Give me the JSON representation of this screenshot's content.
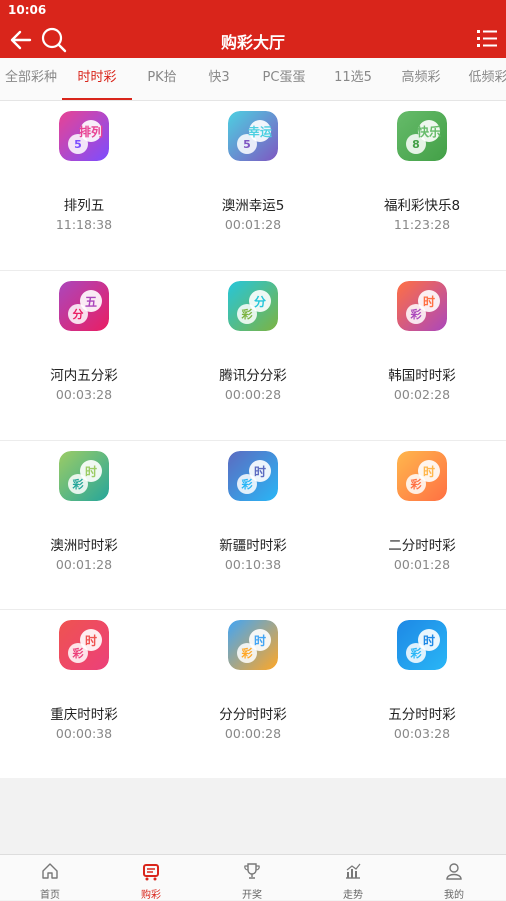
{
  "status": {
    "time": "10:06"
  },
  "header": {
    "title": "购彩大厅",
    "back_icon": "back-arrow-icon",
    "search_icon": "search-icon",
    "menu_icon": "list-menu-icon"
  },
  "tabs": [
    {
      "label": "全部彩种",
      "active": false
    },
    {
      "label": "时时彩",
      "active": true
    },
    {
      "label": "PK拾",
      "active": false
    },
    {
      "label": "快3",
      "active": false
    },
    {
      "label": "PC蛋蛋",
      "active": false
    },
    {
      "label": "11选5",
      "active": false
    },
    {
      "label": "高频彩",
      "active": false
    },
    {
      "label": "低频彩",
      "active": false
    }
  ],
  "lotteries": [
    {
      "name": "排列五",
      "time": "11:18:38",
      "icon_text": "排列",
      "icon_sub": "5",
      "colors": [
        "#e84393",
        "#7c4dff"
      ]
    },
    {
      "name": "澳洲幸运5",
      "time": "00:01:28",
      "icon_text": "幸运",
      "icon_sub": "5",
      "colors": [
        "#4dd0e1",
        "#7e57c2"
      ]
    },
    {
      "name": "福利彩快乐8",
      "time": "11:23:28",
      "icon_text": "快乐",
      "icon_sub": "8",
      "colors": [
        "#66bb6a",
        "#43a047"
      ]
    },
    {
      "name": "河内五分彩",
      "time": "00:03:28",
      "icon_text": "五",
      "icon_sub": "分",
      "colors": [
        "#ab47bc",
        "#e91e63"
      ]
    },
    {
      "name": "腾讯分分彩",
      "time": "00:00:28",
      "icon_text": "分",
      "icon_sub": "彩",
      "colors": [
        "#26c6da",
        "#7cb342"
      ]
    },
    {
      "name": "韩国时时彩",
      "time": "00:02:28",
      "icon_text": "时",
      "icon_sub": "彩",
      "colors": [
        "#ff7043",
        "#ab47bc"
      ]
    },
    {
      "name": "澳洲时时彩",
      "time": "00:01:28",
      "icon_text": "时",
      "icon_sub": "彩",
      "colors": [
        "#9ccc65",
        "#26a69a"
      ]
    },
    {
      "name": "新疆时时彩",
      "time": "00:10:38",
      "icon_text": "时",
      "icon_sub": "彩",
      "colors": [
        "#5c6bc0",
        "#29b6f6"
      ]
    },
    {
      "name": "二分时时彩",
      "time": "00:01:28",
      "icon_text": "时",
      "icon_sub": "彩",
      "colors": [
        "#ffb74d",
        "#ff7043"
      ]
    },
    {
      "name": "重庆时时彩",
      "time": "00:00:38",
      "icon_text": "时",
      "icon_sub": "彩",
      "colors": [
        "#ef5350",
        "#ec407a"
      ]
    },
    {
      "name": "分分时时彩",
      "time": "00:00:28",
      "icon_text": "时",
      "icon_sub": "彩",
      "colors": [
        "#42a5f5",
        "#ffa726"
      ]
    },
    {
      "name": "五分时时彩",
      "time": "00:03:28",
      "icon_text": "时",
      "icon_sub": "彩",
      "colors": [
        "#1e88e5",
        "#29b6f6"
      ]
    }
  ],
  "nav": [
    {
      "label": "首页",
      "icon": "home-icon",
      "active": false
    },
    {
      "label": "购彩",
      "icon": "cart-icon",
      "active": true
    },
    {
      "label": "开奖",
      "icon": "trophy-icon",
      "active": false
    },
    {
      "label": "走势",
      "icon": "chart-icon",
      "active": false
    },
    {
      "label": "我的",
      "icon": "user-icon",
      "active": false
    }
  ],
  "accent_color": "#d9251b"
}
